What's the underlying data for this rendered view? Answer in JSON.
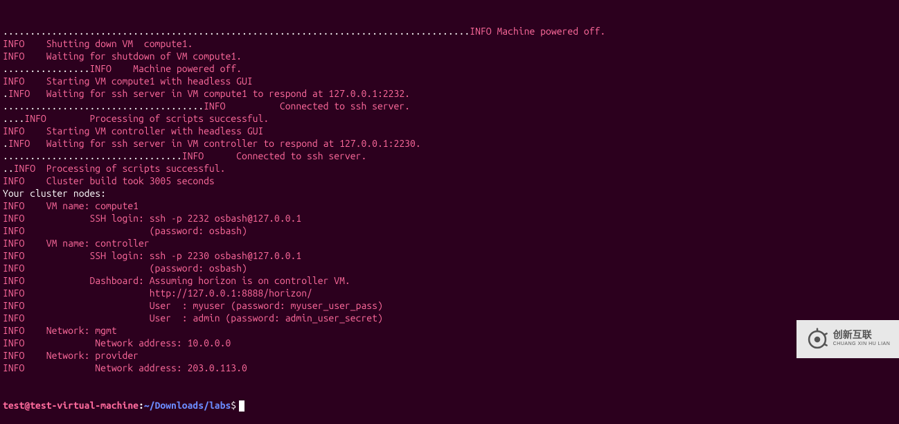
{
  "lines": [
    {
      "segments": [
        {
          "cls": "dots",
          "text": "......................................................................................"
        },
        {
          "cls": "info",
          "text": "INFO Machine powered off."
        }
      ]
    },
    {
      "segments": [
        {
          "cls": "info",
          "text": "INFO\tShutting down VM  compute1."
        }
      ]
    },
    {
      "segments": [
        {
          "cls": "info",
          "text": "INFO\tWaiting for shutdown of VM compute1."
        }
      ]
    },
    {
      "segments": [
        {
          "cls": "dots",
          "text": "................"
        },
        {
          "cls": "info",
          "text": "INFO    Machine powered off."
        }
      ]
    },
    {
      "segments": [
        {
          "cls": "info",
          "text": "INFO\tStarting VM compute1 with headless GUI"
        }
      ]
    },
    {
      "segments": [
        {
          "cls": "dots",
          "text": "."
        },
        {
          "cls": "info",
          "text": "INFO\tWaiting for ssh server in VM compute1 to respond at 127.0.0.1:2232."
        }
      ]
    },
    {
      "segments": [
        {
          "cls": "dots",
          "text": "....................................."
        },
        {
          "cls": "info",
          "text": "INFO          Connected to ssh server."
        }
      ]
    },
    {
      "segments": [
        {
          "cls": "dots",
          "text": "...."
        },
        {
          "cls": "info",
          "text": "INFO        Processing of scripts successful."
        }
      ]
    },
    {
      "segments": [
        {
          "cls": "info",
          "text": "INFO\tStarting VM controller with headless GUI"
        }
      ]
    },
    {
      "segments": [
        {
          "cls": "dots",
          "text": "."
        },
        {
          "cls": "info",
          "text": "INFO\tWaiting for ssh server in VM controller to respond at 127.0.0.1:2230."
        }
      ]
    },
    {
      "segments": [
        {
          "cls": "dots",
          "text": "................................."
        },
        {
          "cls": "info",
          "text": "INFO      Connected to ssh server."
        }
      ]
    },
    {
      "segments": [
        {
          "cls": "dots",
          "text": ".."
        },
        {
          "cls": "info",
          "text": "INFO\tProcessing of scripts successful."
        }
      ]
    },
    {
      "segments": [
        {
          "cls": "info",
          "text": "INFO\tCluster build took 3005 seconds"
        }
      ]
    },
    {
      "segments": [
        {
          "cls": "white-text",
          "text": "Your cluster nodes:"
        }
      ]
    },
    {
      "segments": [
        {
          "cls": "info",
          "text": "INFO\tVM name: compute1"
        }
      ]
    },
    {
      "segments": [
        {
          "cls": "info",
          "text": "INFO\t        SSH login: ssh -p 2232 osbash@127.0.0.1"
        }
      ]
    },
    {
      "segments": [
        {
          "cls": "info",
          "text": "INFO\t                   (password: osbash)"
        }
      ]
    },
    {
      "segments": [
        {
          "cls": "info",
          "text": "INFO\tVM name: controller"
        }
      ]
    },
    {
      "segments": [
        {
          "cls": "info",
          "text": "INFO\t        SSH login: ssh -p 2230 osbash@127.0.0.1"
        }
      ]
    },
    {
      "segments": [
        {
          "cls": "info",
          "text": "INFO\t                   (password: osbash)"
        }
      ]
    },
    {
      "segments": [
        {
          "cls": "info",
          "text": "INFO\t        Dashboard: Assuming horizon is on controller VM."
        }
      ]
    },
    {
      "segments": [
        {
          "cls": "info",
          "text": "INFO\t                   http://127.0.0.1:8888/horizon/"
        }
      ]
    },
    {
      "segments": [
        {
          "cls": "info",
          "text": "INFO\t                   User  : myuser (password: myuser_user_pass)"
        }
      ]
    },
    {
      "segments": [
        {
          "cls": "info",
          "text": "INFO\t                   User  : admin (password: admin_user_secret)"
        }
      ]
    },
    {
      "segments": [
        {
          "cls": "info",
          "text": "INFO\tNetwork: mgmt"
        }
      ]
    },
    {
      "segments": [
        {
          "cls": "info",
          "text": "INFO\t         Network address: 10.0.0.0"
        }
      ]
    },
    {
      "segments": [
        {
          "cls": "info",
          "text": "INFO\tNetwork: provider"
        }
      ]
    },
    {
      "segments": [
        {
          "cls": "info",
          "text": "INFO\t         Network address: 203.0.113.0"
        }
      ]
    }
  ],
  "prompt": {
    "user": "test@test-virtual-machine",
    "colon": ":",
    "path": "~/Downloads/labs",
    "dollar": "$"
  },
  "watermark": {
    "line1": "创新互联",
    "line2": "CHUANG XIN HU LIAN"
  }
}
